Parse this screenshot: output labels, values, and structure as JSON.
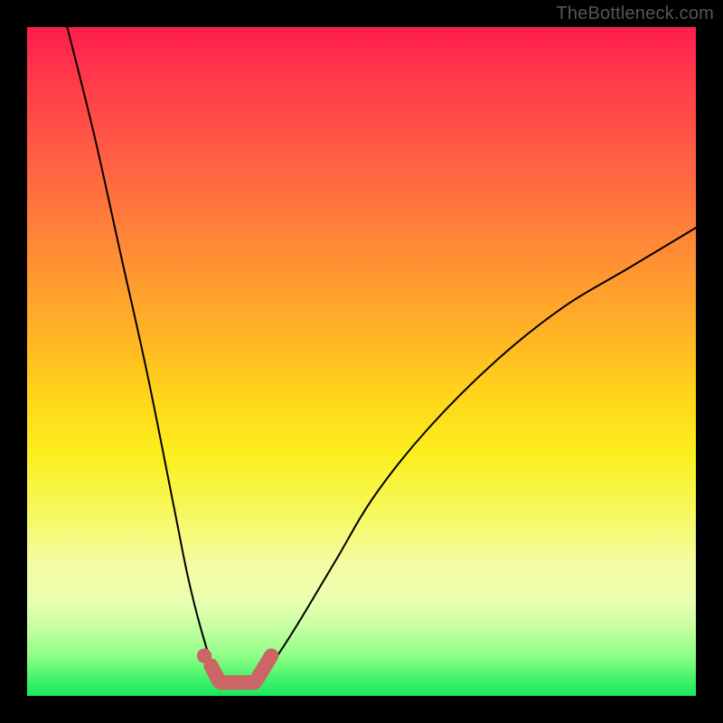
{
  "watermark": "TheBottleneck.com",
  "colors": {
    "frame": "#000000",
    "curve_stroke": "#000000",
    "marker_stroke": "#cc6666",
    "marker_fill_dot": "#cc6666",
    "gradient_top": "#ff1d4d",
    "gradient_bottom": "#18e85a"
  },
  "chart_data": {
    "type": "line",
    "title": "",
    "xlabel": "",
    "ylabel": "",
    "xlim": [
      0,
      100
    ],
    "ylim": [
      0,
      100
    ],
    "grid": false,
    "axes_visible": false,
    "description": "V-shaped bottleneck curve on vertical red→yellow→green gradient. Lower y is better (green). Minimum plateau around x≈28–35, y≈2. Curve rises steeply to y≈100 toward x=0 and more gradually toward y≈70 at x=100.",
    "series": [
      {
        "name": "bottleneck-curve",
        "stroke": "#000000",
        "x": [
          6,
          10,
          14,
          18,
          22,
          24,
          26,
          28,
          30,
          32,
          34,
          36,
          40,
          46,
          52,
          60,
          70,
          80,
          90,
          100
        ],
        "y": [
          100,
          84,
          66,
          48,
          28,
          18,
          10,
          4,
          2,
          2,
          2,
          4,
          10,
          20,
          30,
          40,
          50,
          58,
          64,
          70
        ]
      }
    ],
    "markers": [
      {
        "shape": "dot",
        "x": 26.5,
        "y": 6,
        "r_pct": 1.1,
        "color": "#cc6666"
      },
      {
        "shape": "line",
        "x1": 27.5,
        "y1": 4.5,
        "x2": 28.7,
        "y2": 2.2,
        "w_pct": 2.2,
        "color": "#cc6666"
      },
      {
        "shape": "line",
        "x1": 29.0,
        "y1": 2.0,
        "x2": 34.0,
        "y2": 2.0,
        "w_pct": 2.2,
        "color": "#cc6666"
      },
      {
        "shape": "line",
        "x1": 34.2,
        "y1": 2.2,
        "x2": 36.5,
        "y2": 6.0,
        "w_pct": 2.2,
        "color": "#cc6666"
      }
    ]
  }
}
